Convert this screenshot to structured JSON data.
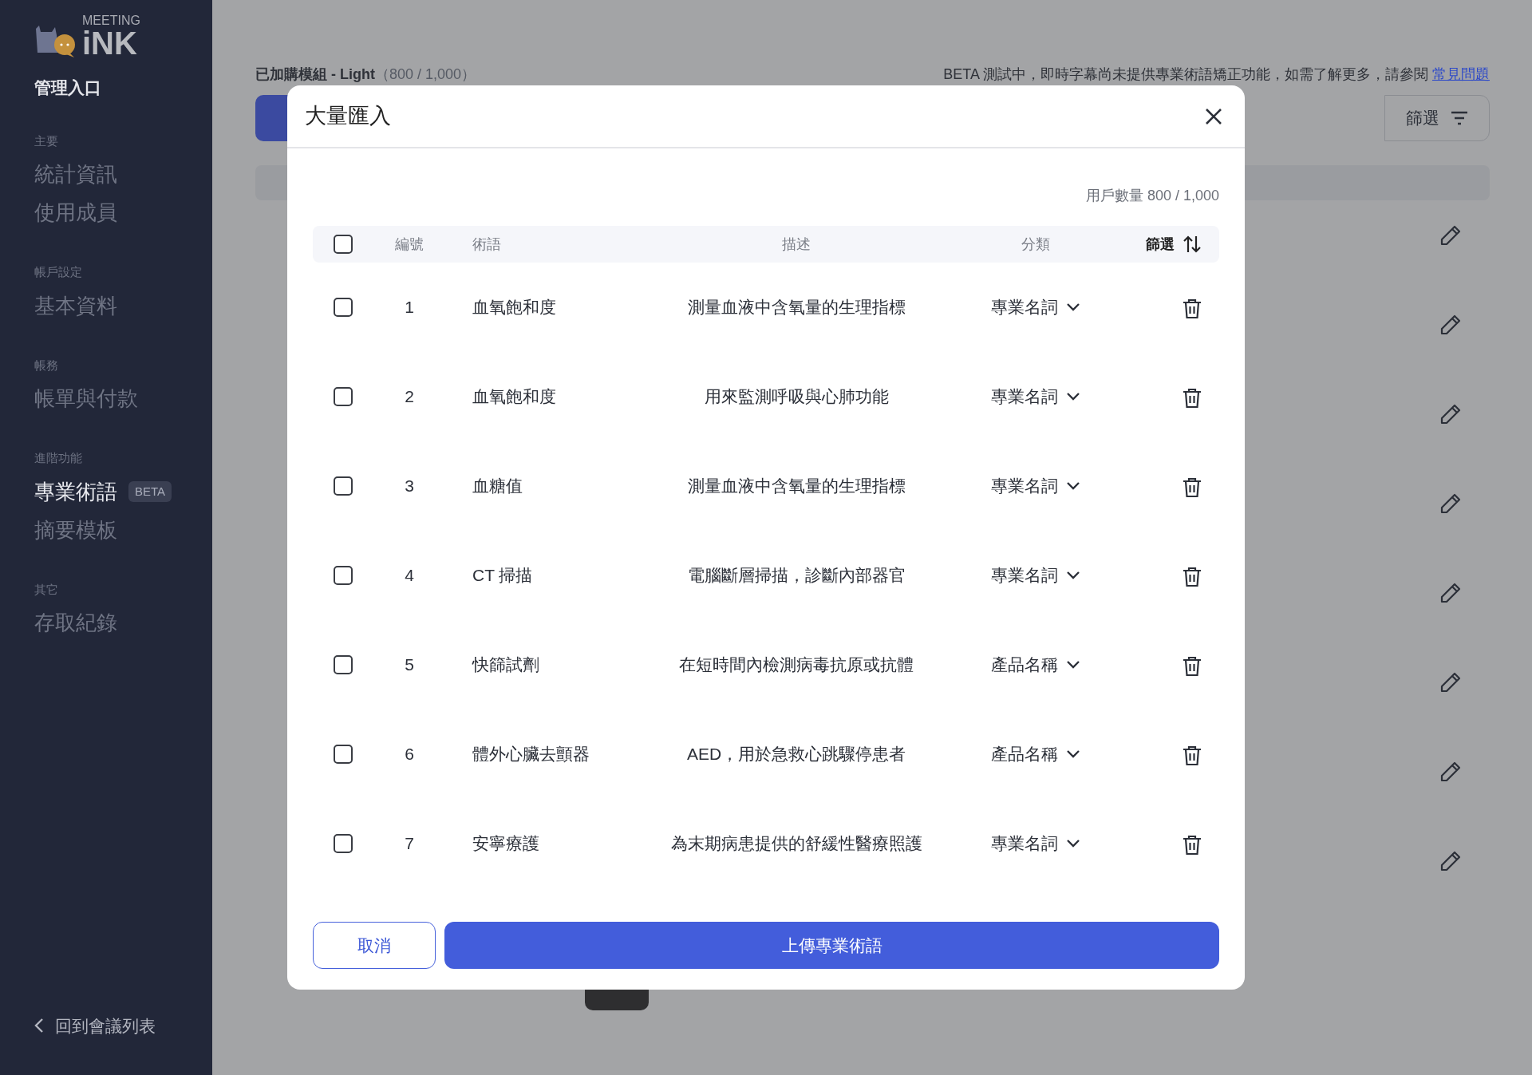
{
  "sidebar": {
    "logo": {
      "top": "MEETING",
      "main": "iNK"
    },
    "portal": "管理入口",
    "sections": [
      {
        "heading": "主要",
        "items": [
          {
            "label": "統計資訊",
            "selected": false
          },
          {
            "label": "使用成員",
            "selected": false
          }
        ]
      },
      {
        "heading": "帳戶設定",
        "items": [
          {
            "label": "基本資料",
            "selected": false
          }
        ]
      },
      {
        "heading": "帳務",
        "items": [
          {
            "label": "帳單與付款",
            "selected": false
          }
        ]
      },
      {
        "heading": "進階功能",
        "items": [
          {
            "label": "專業術語",
            "selected": true,
            "badge": "BETA"
          },
          {
            "label": "摘要模板",
            "selected": false
          }
        ]
      },
      {
        "heading": "其它",
        "items": [
          {
            "label": "存取紀錄",
            "selected": false
          }
        ]
      }
    ],
    "back": "回到會議列表"
  },
  "main": {
    "plan_label": "已加購模組 - Light",
    "plan_usage": "（800 / 1,000）",
    "notice": "BETA 測試中，即時字幕尚未提供專業術語矯正功能，如需了解更多，請參閱",
    "notice_link": "常見問題",
    "filter_button": "篩選"
  },
  "modal": {
    "title": "大量匯入",
    "count": "用戶數量 800 / 1,000",
    "columns": [
      "編號",
      "術語",
      "描述",
      "分類"
    ],
    "filter_label": "篩選",
    "all_checked": false,
    "rows": [
      {
        "checked": false,
        "number": "1",
        "term": "血氧飽和度",
        "description": "測量血液中含氧量的生理指標",
        "category": "專業名詞"
      },
      {
        "checked": false,
        "number": "2",
        "term": "血氧飽和度",
        "description": "用來監測呼吸與心肺功能",
        "category": "專業名詞"
      },
      {
        "checked": false,
        "number": "3",
        "term": "血糖值",
        "description": "測量血液中含氧量的生理指標",
        "category": "專業名詞"
      },
      {
        "checked": false,
        "number": "4",
        "term": "CT 掃描",
        "description": "電腦斷層掃描，診斷內部器官",
        "category": "專業名詞"
      },
      {
        "checked": false,
        "number": "5",
        "term": "快篩試劑",
        "description": "在短時間內檢測病毒抗原或抗體",
        "category": "產品名稱"
      },
      {
        "checked": false,
        "number": "6",
        "term": "體外心臟去顫器",
        "description": "AED，用於急救心跳驟停患者",
        "category": "產品名稱"
      },
      {
        "checked": false,
        "number": "7",
        "term": "安寧療護",
        "description": "為末期病患提供的舒緩性醫療照護",
        "category": "專業名詞"
      }
    ],
    "cancel": "取消",
    "submit": "上傳專業術語"
  }
}
